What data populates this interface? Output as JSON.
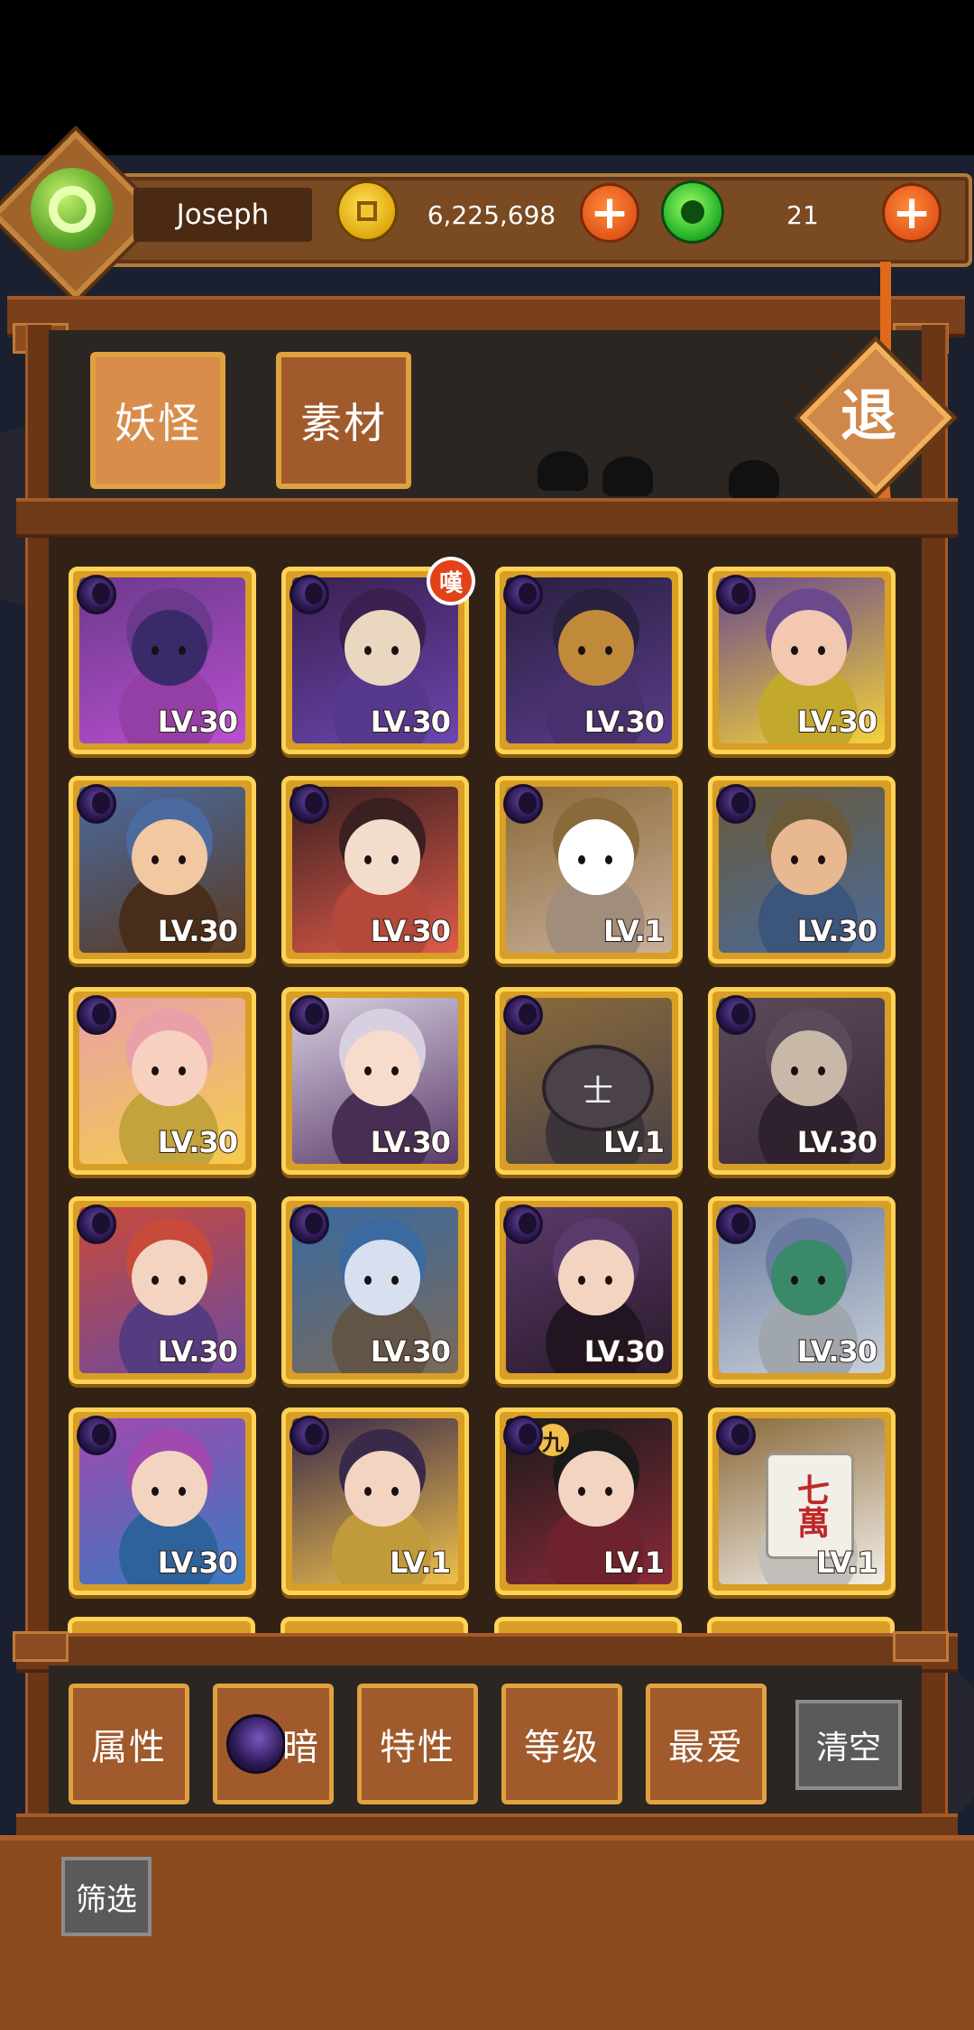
{
  "player": {
    "name": "Joseph",
    "coins": "6,225,698",
    "gems": "21"
  },
  "tabs": [
    {
      "label": "妖怪",
      "active": true
    },
    {
      "label": "素材",
      "active": false
    }
  ],
  "exit_label": "退",
  "characters": [
    {
      "level": "LV.30",
      "colors": [
        "#6b3a8c",
        "#b94fd0",
        "#3a2a6a"
      ]
    },
    {
      "level": "LV.30",
      "colors": [
        "#3a2050",
        "#6b46b0",
        "#e9d7c0"
      ],
      "badge": "嘆"
    },
    {
      "level": "LV.30",
      "colors": [
        "#2a2040",
        "#5a3c8a",
        "#c08a3a"
      ]
    },
    {
      "level": "LV.30",
      "colors": [
        "#6a4a8c",
        "#f4d23a",
        "#f2c8b0"
      ]
    },
    {
      "level": "LV.30",
      "colors": [
        "#4a6aa0",
        "#5a3a20",
        "#f1c8a0"
      ]
    },
    {
      "level": "LV.30",
      "colors": [
        "#3a2020",
        "#e05a4a",
        "#f4dccc"
      ]
    },
    {
      "level": "LV.1",
      "colors": [
        "#8a6a3a",
        "#c9b09a",
        "#ffffff"
      ]
    },
    {
      "level": "LV.30",
      "colors": [
        "#6a5a3a",
        "#4a6a9a",
        "#e8b890"
      ]
    },
    {
      "level": "LV.30",
      "colors": [
        "#e9a0a8",
        "#f4cc4a",
        "#f7d0c0"
      ]
    },
    {
      "level": "LV.30",
      "colors": [
        "#d8d0e0",
        "#5a3a6a",
        "#f7dccc"
      ]
    },
    {
      "level": "LV.1",
      "colors": [
        "#8a6a3a",
        "#4a4248",
        "#6a6268"
      ]
    },
    {
      "level": "LV.30",
      "colors": [
        "#5a4a5a",
        "#3a2a3a",
        "#c8b8a8"
      ]
    },
    {
      "level": "LV.30",
      "colors": [
        "#c84a3a",
        "#6a4aa0",
        "#f3d4c0"
      ]
    },
    {
      "level": "LV.30",
      "colors": [
        "#3a6aa0",
        "#7a6a5a",
        "#d8e0f0"
      ]
    },
    {
      "level": "LV.30",
      "colors": [
        "#5a3a6a",
        "#2a1a2a",
        "#f3d4c0"
      ]
    },
    {
      "level": "LV.30",
      "colors": [
        "#6a7aa0",
        "#c8d0d8",
        "#3a8a6a"
      ]
    },
    {
      "level": "LV.30",
      "colors": [
        "#a04ab0",
        "#3a7ac0",
        "#f3d4c0"
      ]
    },
    {
      "level": "LV.1",
      "colors": [
        "#3a2a4a",
        "#f0c04a",
        "#f3d4c0"
      ]
    },
    {
      "level": "LV.1",
      "colors": [
        "#1a1a1a",
        "#8a2a3a",
        "#f3d4c0"
      ],
      "badge_glyph": "九"
    },
    {
      "level": "LV.1",
      "colors": [
        "#8a6a3a",
        "#f2eee8",
        "#c0282a"
      ],
      "tile_glyph": "七萬"
    }
  ],
  "filters": [
    {
      "label": "属性"
    },
    {
      "label": "暗",
      "orb": true
    },
    {
      "label": "特性"
    },
    {
      "label": "等级"
    },
    {
      "label": "最爱"
    }
  ],
  "clear_label": "清空",
  "screen_label": "筛选",
  "colors": {
    "frame": "#7a3f1b",
    "card_gold": "#ffd356",
    "tab_active": "#d98d4b",
    "tab_inactive": "#a05a2c",
    "coin_plus": "#e2561a"
  }
}
